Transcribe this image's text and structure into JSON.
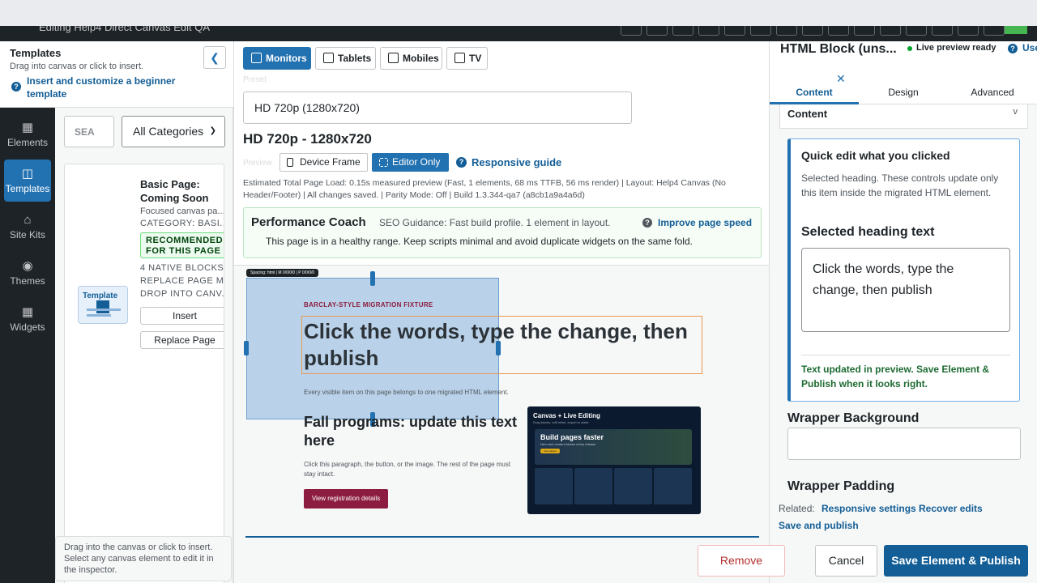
{
  "topbar": {
    "title": "Editing Help4 Direct Canvas Edit QA"
  },
  "left_rail": {
    "items": [
      {
        "label": "Elements",
        "icon": "grid-icon"
      },
      {
        "label": "Templates",
        "icon": "layout-icon",
        "active": true
      },
      {
        "label": "Site Kits",
        "icon": "house-icon"
      },
      {
        "label": "Themes",
        "icon": "palette-icon"
      },
      {
        "label": "Widgets",
        "icon": "widgets-icon"
      }
    ]
  },
  "templates_panel": {
    "title": "Templates",
    "subtitle": "Drag into canvas or click to insert.",
    "insert_link": "Insert and customize a beginner template",
    "search_value": "SEA",
    "category_select": "All Categories",
    "card": {
      "thumb_label": "Template",
      "title": "Basic Page: Coming Soon",
      "desc": "Focused canvas pa...",
      "category": "CATEGORY: BASI...",
      "recommended": "RECOMMENDED FOR THIS PAGE",
      "meta": [
        "4 NATIVE BLOCKS",
        "REPLACE PAGE M...",
        "DROP INTO CANV..."
      ],
      "insert_label": "Insert",
      "replace_label": "Replace Page"
    },
    "tip": "Drag into the canvas or click to insert. Select any canvas element to edit it in the inspector."
  },
  "toolbar": {
    "devices": [
      {
        "label": "Monitors",
        "active": true
      },
      {
        "label": "Tablets"
      },
      {
        "label": "Mobiles"
      },
      {
        "label": "TV"
      }
    ],
    "preset_label": "Preset",
    "preset_value": "HD 720p (1280x720)",
    "size_heading": "HD 720p - 1280x720",
    "preview_label": "Preview",
    "device_frame": "Device Frame",
    "editor_only": "Editor Only",
    "responsive_guide": "Responsive guide",
    "stats": "Estimated Total Page Load: 0.15s measured preview (Fast, 1 elements, 68 ms TTFB, 56 ms render)  |  Layout: Help4 Canvas (No Header/Footer)  |  All changes saved.  |  Parity Mode: Off  |  Build 1.3.344-qa7 (a8cb1a9a4a6d)"
  },
  "coach": {
    "title": "Performance Coach",
    "seo": "SEO Guidance: Fast build profile. 1 element in layout.",
    "link": "Improve page speed",
    "message": "This page is in a healthy range. Keep scripts minimal and avoid duplicate widgets on the same fold."
  },
  "canvas": {
    "spacing_tag": "Spacing: html | M 0/0/0/0 | P 0/0/0/0",
    "eyebrow": "BARCLAY-STYLE MIGRATION FIXTURE",
    "heading": "Click the words, type the change, then publish",
    "subtext": "Every visible item on this page belongs to one migrated HTML element.",
    "fall_heading": "Fall programs: update this text here",
    "fall_paragraph": "Click this paragraph, the button, or the image. The rest of the page must stay intact.",
    "button": "View registration details",
    "promo": {
      "title": "Canvas + Live Editing",
      "subtitle": "Drag blocks, edit inline, export to static",
      "banner_title": "Build pages faster",
      "banner_sub": "Hero and content blocks every release",
      "banner_btn": "Get started"
    }
  },
  "inspector": {
    "title": "HTML Block (uns...",
    "live_status": "Live preview ready",
    "use_link": "Use",
    "tabs": [
      {
        "label": "Content",
        "active": true
      },
      {
        "label": "Design"
      },
      {
        "label": "Advanced"
      }
    ],
    "section_title": "Content",
    "section_toggle": "v",
    "quick_edit": {
      "title": "Quick edit what you clicked",
      "desc": "Selected heading. These controls update only this item inside the migrated HTML element.",
      "field_label": "Selected heading text",
      "field_value": "Click the words, type the change, then publish",
      "status": "Text updated in preview. Save Element & Publish when it looks right."
    },
    "wrapper_background_label": "Wrapper Background",
    "wrapper_background_value": "",
    "wrapper_padding_label": "Wrapper Padding",
    "related_label": "Related:",
    "related_links": [
      "Responsive settings",
      "Recover edits",
      "Save and publish"
    ]
  },
  "actions": {
    "remove": "Remove Element",
    "cancel": "Cancel",
    "save": "Save Element & Publish"
  },
  "colors": {
    "accent": "#2271b1",
    "brand": "#8c1d40",
    "success": "#00a32a"
  }
}
